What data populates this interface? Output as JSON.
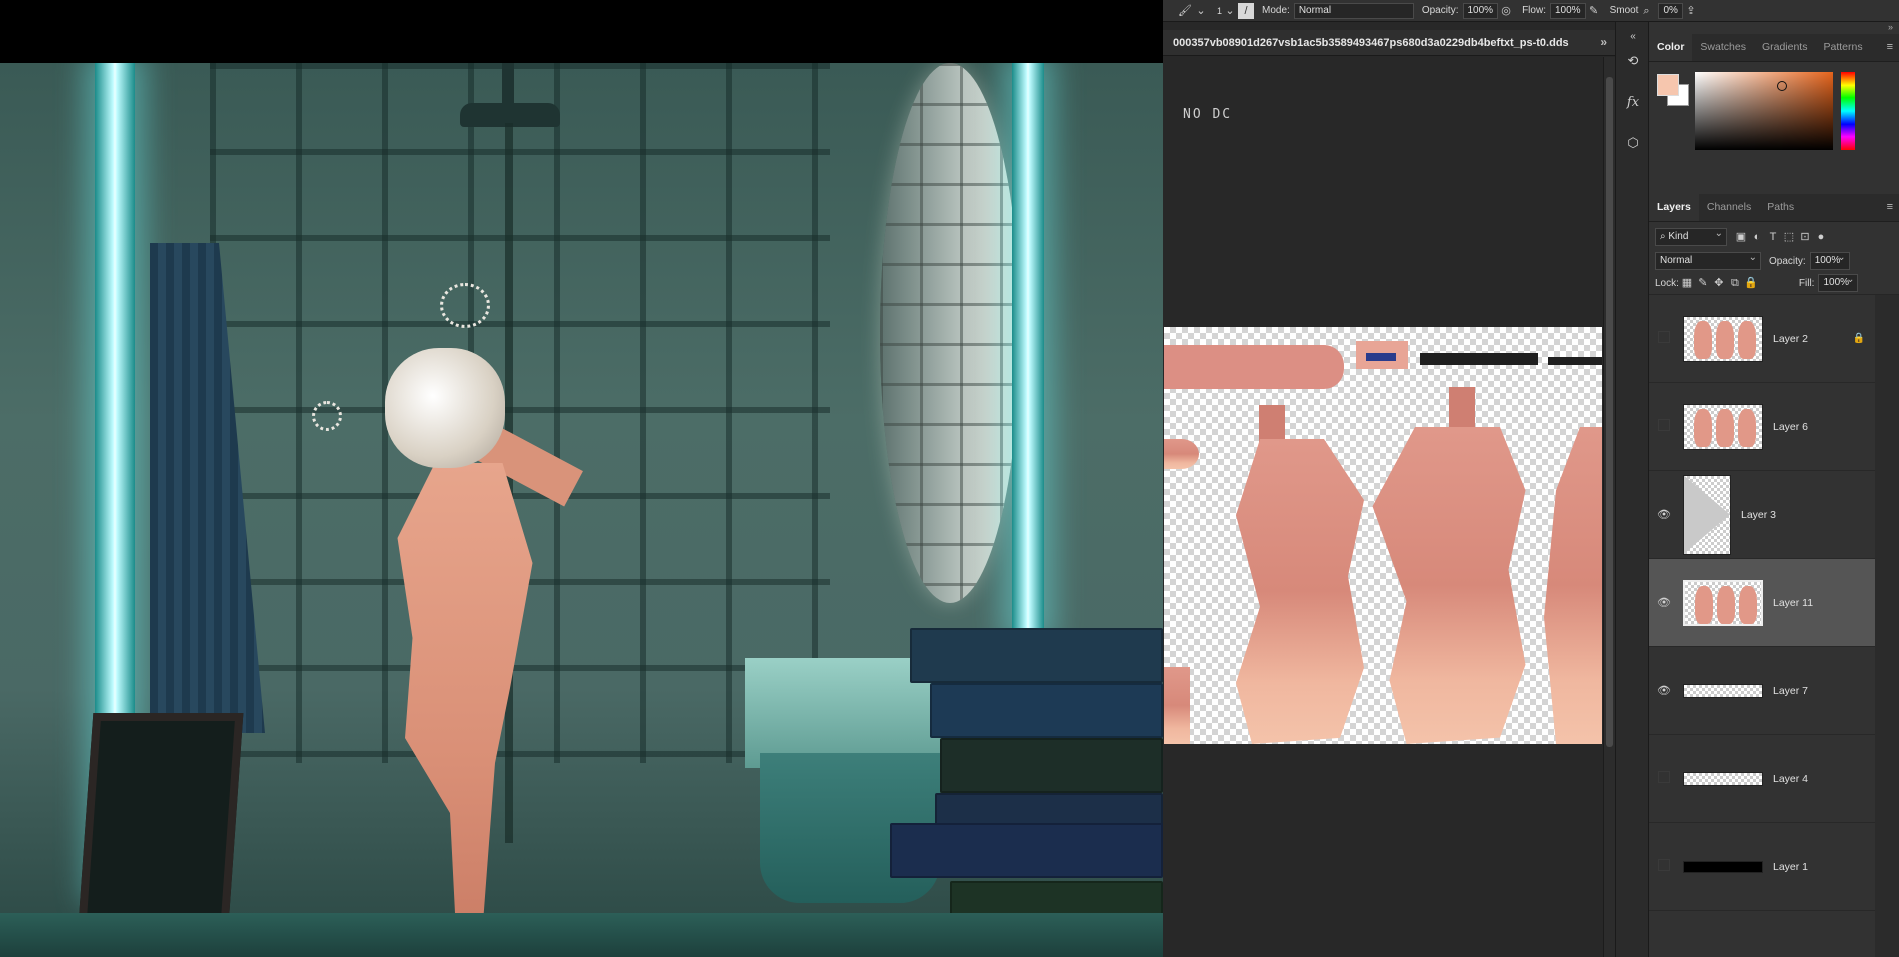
{
  "options_bar": {
    "brush_size": "1",
    "mode_label": "Mode:",
    "mode_value": "Normal",
    "opacity_label": "Opacity:",
    "opacity_value": "100%",
    "flow_label": "Flow:",
    "flow_value": "100%",
    "smooth_label": "Smoot",
    "smooth_value": "0%"
  },
  "document": {
    "tab_title": "000357vb08901d267vsb1ac5b3589493467ps680d3a0229db4beftxt_ps-t0.dds",
    "canvas_text": "NO DC"
  },
  "color_panel": {
    "tabs": [
      "Color",
      "Swatches",
      "Gradients",
      "Patterns"
    ],
    "foreground": "#f6c6ae",
    "background": "#ffffff"
  },
  "layers_panel": {
    "tabs": [
      "Layers",
      "Channels",
      "Paths"
    ],
    "filter_kind": "Kind",
    "blend_mode": "Normal",
    "opacity_label": "Opacity:",
    "opacity_value": "100%",
    "lock_label": "Lock:",
    "fill_label": "Fill:",
    "fill_value": "100%",
    "layers": [
      {
        "name": "Layer 2",
        "visible": false,
        "locked": true,
        "thumb": "figures"
      },
      {
        "name": "Layer 6",
        "visible": false,
        "locked": false,
        "thumb": "figures"
      },
      {
        "name": "Layer 3",
        "visible": true,
        "locked": false,
        "thumb": "grey"
      },
      {
        "name": "Layer 11",
        "visible": true,
        "locked": false,
        "thumb": "figures",
        "selected": true
      },
      {
        "name": "Layer 7",
        "visible": true,
        "locked": false,
        "thumb": "thin"
      },
      {
        "name": "Layer 4",
        "visible": false,
        "locked": false,
        "thumb": "thin"
      },
      {
        "name": "Layer 1",
        "visible": false,
        "locked": false,
        "thumb": "black"
      }
    ]
  },
  "icons": {
    "brush": "brush-icon",
    "eye": "eye-icon",
    "lock": "lock-icon",
    "search": "search-icon",
    "history": "history-icon",
    "fx": "fx-icon",
    "3d": "cube-icon"
  }
}
